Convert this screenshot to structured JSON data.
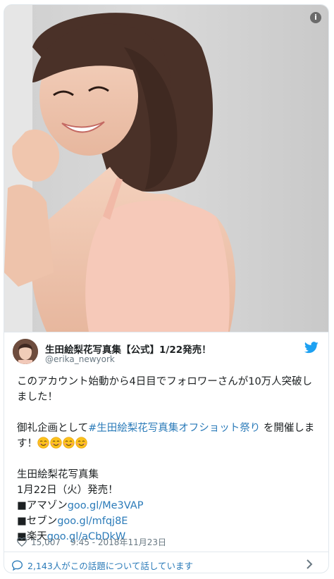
{
  "tweet": {
    "display_name": "生田絵梨花写真集【公式】1/22発売！",
    "handle": "@erika_newyork",
    "line1": "このアカウント始動から4日目でフォロワーさんが10万人突破しました！",
    "para2_prefix": "御礼企画として",
    "hashtag": "#生田絵梨花写真集オフショット祭り",
    "para2_suffix": "を開催します！",
    "info_title": "生田絵梨花写真集",
    "release": "1月22日（火）発売！",
    "stores": [
      {
        "label": "■アマゾン",
        "link": "goo.gl/Me3VAP"
      },
      {
        "label": "■セブン",
        "link": "goo.gl/mfqj8E"
      },
      {
        "label": "■楽天",
        "link": "goo.gl/aCbDkW"
      }
    ],
    "likes": "15,007",
    "timestamp": "9:45 - 2018年11月23日",
    "footer_text": "2,143人がこの話題について話しています",
    "emoji_count": 4
  },
  "colors": {
    "link": "#2b7bb9",
    "twitter_blue": "#1da1f2",
    "muted": "#697882"
  },
  "icons": {
    "info": "info-icon",
    "bird": "twitter-bird-icon",
    "heart": "heart-icon",
    "bubble": "speech-bubble-icon",
    "chevron": "chevron-right-icon"
  }
}
